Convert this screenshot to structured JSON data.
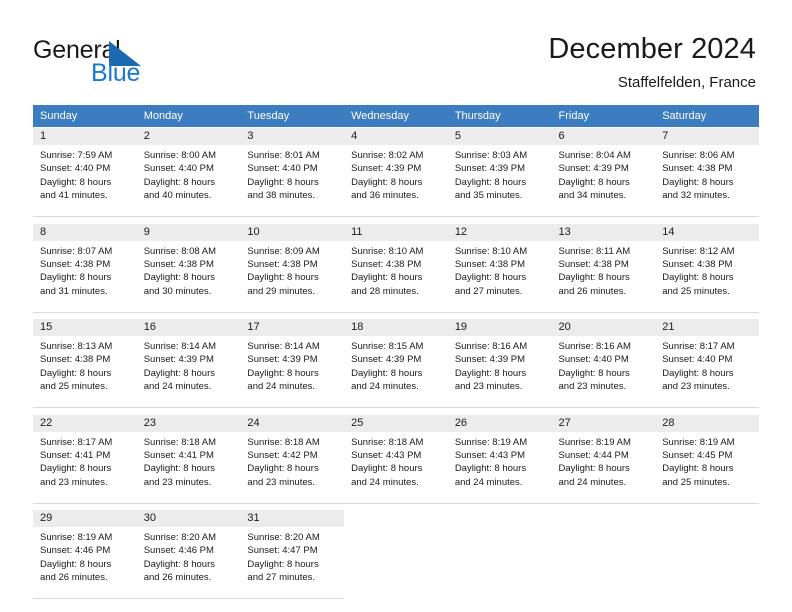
{
  "brand": {
    "name_part1": "General",
    "name_part2": "Blue",
    "flag_icon": "triangle-flag-icon",
    "colors": {
      "blue": "#1b7ad0",
      "flag": "#1b69b0",
      "dark": "#1a1a1a"
    }
  },
  "header": {
    "title": "December 2024",
    "subtitle": "Staffelfelden, France"
  },
  "calendar": {
    "accent_color": "#3b7dc0",
    "daynum_band_color": "#ececec",
    "weekday_headers": [
      "Sunday",
      "Monday",
      "Tuesday",
      "Wednesday",
      "Thursday",
      "Friday",
      "Saturday"
    ],
    "weeks": [
      [
        {
          "day": "1",
          "sunrise": "Sunrise: 7:59 AM",
          "sunset": "Sunset: 4:40 PM",
          "daylight_line1": "Daylight: 8 hours",
          "daylight_line2": "and 41 minutes."
        },
        {
          "day": "2",
          "sunrise": "Sunrise: 8:00 AM",
          "sunset": "Sunset: 4:40 PM",
          "daylight_line1": "Daylight: 8 hours",
          "daylight_line2": "and 40 minutes."
        },
        {
          "day": "3",
          "sunrise": "Sunrise: 8:01 AM",
          "sunset": "Sunset: 4:40 PM",
          "daylight_line1": "Daylight: 8 hours",
          "daylight_line2": "and 38 minutes."
        },
        {
          "day": "4",
          "sunrise": "Sunrise: 8:02 AM",
          "sunset": "Sunset: 4:39 PM",
          "daylight_line1": "Daylight: 8 hours",
          "daylight_line2": "and 36 minutes."
        },
        {
          "day": "5",
          "sunrise": "Sunrise: 8:03 AM",
          "sunset": "Sunset: 4:39 PM",
          "daylight_line1": "Daylight: 8 hours",
          "daylight_line2": "and 35 minutes."
        },
        {
          "day": "6",
          "sunrise": "Sunrise: 8:04 AM",
          "sunset": "Sunset: 4:39 PM",
          "daylight_line1": "Daylight: 8 hours",
          "daylight_line2": "and 34 minutes."
        },
        {
          "day": "7",
          "sunrise": "Sunrise: 8:06 AM",
          "sunset": "Sunset: 4:38 PM",
          "daylight_line1": "Daylight: 8 hours",
          "daylight_line2": "and 32 minutes."
        }
      ],
      [
        {
          "day": "8",
          "sunrise": "Sunrise: 8:07 AM",
          "sunset": "Sunset: 4:38 PM",
          "daylight_line1": "Daylight: 8 hours",
          "daylight_line2": "and 31 minutes."
        },
        {
          "day": "9",
          "sunrise": "Sunrise: 8:08 AM",
          "sunset": "Sunset: 4:38 PM",
          "daylight_line1": "Daylight: 8 hours",
          "daylight_line2": "and 30 minutes."
        },
        {
          "day": "10",
          "sunrise": "Sunrise: 8:09 AM",
          "sunset": "Sunset: 4:38 PM",
          "daylight_line1": "Daylight: 8 hours",
          "daylight_line2": "and 29 minutes."
        },
        {
          "day": "11",
          "sunrise": "Sunrise: 8:10 AM",
          "sunset": "Sunset: 4:38 PM",
          "daylight_line1": "Daylight: 8 hours",
          "daylight_line2": "and 28 minutes."
        },
        {
          "day": "12",
          "sunrise": "Sunrise: 8:10 AM",
          "sunset": "Sunset: 4:38 PM",
          "daylight_line1": "Daylight: 8 hours",
          "daylight_line2": "and 27 minutes."
        },
        {
          "day": "13",
          "sunrise": "Sunrise: 8:11 AM",
          "sunset": "Sunset: 4:38 PM",
          "daylight_line1": "Daylight: 8 hours",
          "daylight_line2": "and 26 minutes."
        },
        {
          "day": "14",
          "sunrise": "Sunrise: 8:12 AM",
          "sunset": "Sunset: 4:38 PM",
          "daylight_line1": "Daylight: 8 hours",
          "daylight_line2": "and 25 minutes."
        }
      ],
      [
        {
          "day": "15",
          "sunrise": "Sunrise: 8:13 AM",
          "sunset": "Sunset: 4:38 PM",
          "daylight_line1": "Daylight: 8 hours",
          "daylight_line2": "and 25 minutes."
        },
        {
          "day": "16",
          "sunrise": "Sunrise: 8:14 AM",
          "sunset": "Sunset: 4:39 PM",
          "daylight_line1": "Daylight: 8 hours",
          "daylight_line2": "and 24 minutes."
        },
        {
          "day": "17",
          "sunrise": "Sunrise: 8:14 AM",
          "sunset": "Sunset: 4:39 PM",
          "daylight_line1": "Daylight: 8 hours",
          "daylight_line2": "and 24 minutes."
        },
        {
          "day": "18",
          "sunrise": "Sunrise: 8:15 AM",
          "sunset": "Sunset: 4:39 PM",
          "daylight_line1": "Daylight: 8 hours",
          "daylight_line2": "and 24 minutes."
        },
        {
          "day": "19",
          "sunrise": "Sunrise: 8:16 AM",
          "sunset": "Sunset: 4:39 PM",
          "daylight_line1": "Daylight: 8 hours",
          "daylight_line2": "and 23 minutes."
        },
        {
          "day": "20",
          "sunrise": "Sunrise: 8:16 AM",
          "sunset": "Sunset: 4:40 PM",
          "daylight_line1": "Daylight: 8 hours",
          "daylight_line2": "and 23 minutes."
        },
        {
          "day": "21",
          "sunrise": "Sunrise: 8:17 AM",
          "sunset": "Sunset: 4:40 PM",
          "daylight_line1": "Daylight: 8 hours",
          "daylight_line2": "and 23 minutes."
        }
      ],
      [
        {
          "day": "22",
          "sunrise": "Sunrise: 8:17 AM",
          "sunset": "Sunset: 4:41 PM",
          "daylight_line1": "Daylight: 8 hours",
          "daylight_line2": "and 23 minutes."
        },
        {
          "day": "23",
          "sunrise": "Sunrise: 8:18 AM",
          "sunset": "Sunset: 4:41 PM",
          "daylight_line1": "Daylight: 8 hours",
          "daylight_line2": "and 23 minutes."
        },
        {
          "day": "24",
          "sunrise": "Sunrise: 8:18 AM",
          "sunset": "Sunset: 4:42 PM",
          "daylight_line1": "Daylight: 8 hours",
          "daylight_line2": "and 23 minutes."
        },
        {
          "day": "25",
          "sunrise": "Sunrise: 8:18 AM",
          "sunset": "Sunset: 4:43 PM",
          "daylight_line1": "Daylight: 8 hours",
          "daylight_line2": "and 24 minutes."
        },
        {
          "day": "26",
          "sunrise": "Sunrise: 8:19 AM",
          "sunset": "Sunset: 4:43 PM",
          "daylight_line1": "Daylight: 8 hours",
          "daylight_line2": "and 24 minutes."
        },
        {
          "day": "27",
          "sunrise": "Sunrise: 8:19 AM",
          "sunset": "Sunset: 4:44 PM",
          "daylight_line1": "Daylight: 8 hours",
          "daylight_line2": "and 24 minutes."
        },
        {
          "day": "28",
          "sunrise": "Sunrise: 8:19 AM",
          "sunset": "Sunset: 4:45 PM",
          "daylight_line1": "Daylight: 8 hours",
          "daylight_line2": "and 25 minutes."
        }
      ],
      [
        {
          "day": "29",
          "sunrise": "Sunrise: 8:19 AM",
          "sunset": "Sunset: 4:46 PM",
          "daylight_line1": "Daylight: 8 hours",
          "daylight_line2": "and 26 minutes."
        },
        {
          "day": "30",
          "sunrise": "Sunrise: 8:20 AM",
          "sunset": "Sunset: 4:46 PM",
          "daylight_line1": "Daylight: 8 hours",
          "daylight_line2": "and 26 minutes."
        },
        {
          "day": "31",
          "sunrise": "Sunrise: 8:20 AM",
          "sunset": "Sunset: 4:47 PM",
          "daylight_line1": "Daylight: 8 hours",
          "daylight_line2": "and 27 minutes."
        },
        {
          "day": "",
          "sunrise": "",
          "sunset": "",
          "daylight_line1": "",
          "daylight_line2": ""
        },
        {
          "day": "",
          "sunrise": "",
          "sunset": "",
          "daylight_line1": "",
          "daylight_line2": ""
        },
        {
          "day": "",
          "sunrise": "",
          "sunset": "",
          "daylight_line1": "",
          "daylight_line2": ""
        },
        {
          "day": "",
          "sunrise": "",
          "sunset": "",
          "daylight_line1": "",
          "daylight_line2": ""
        }
      ]
    ]
  }
}
